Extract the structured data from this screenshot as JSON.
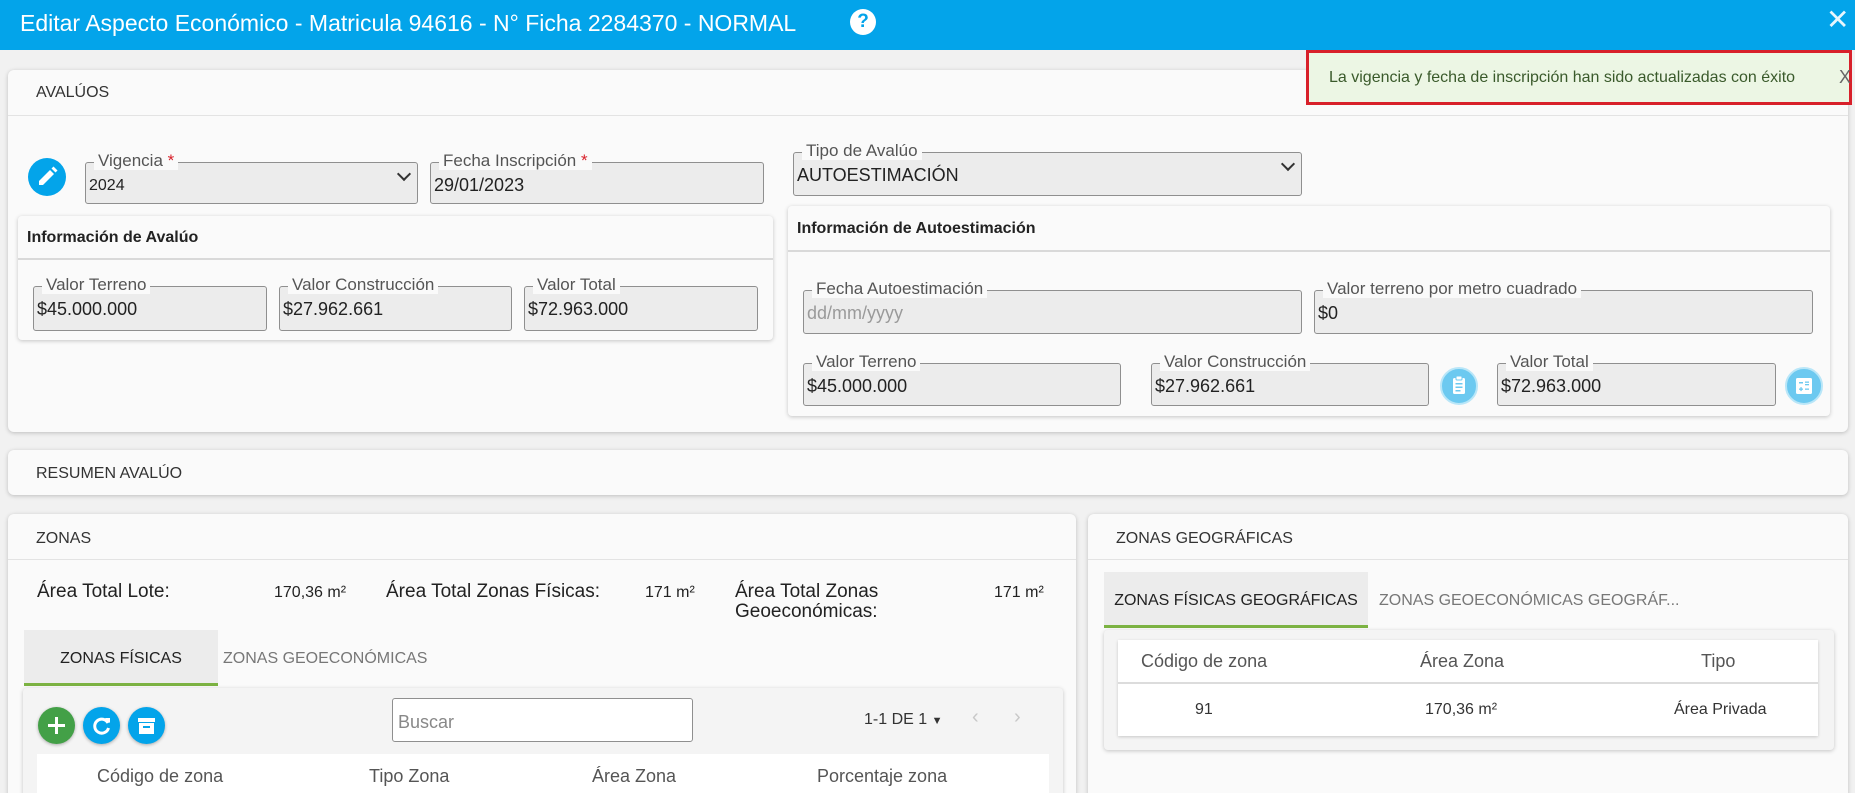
{
  "window": {
    "title": "Editar Aspecto Económico - Matricula 94616 - N° Ficha 2284370 - NORMAL",
    "help_icon": "question-circle-icon",
    "close_icon": "close-icon",
    "accent_color": "#03a4ea"
  },
  "toast": {
    "message": "La vigencia y fecha de inscripción han sido actualizadas con éxito",
    "close": "X",
    "border_color": "#d8202a"
  },
  "avaluos": {
    "header": "AVALÚOS",
    "vigencia": {
      "label": "Vigencia",
      "required": "*",
      "value": "2024"
    },
    "fecha_inscripcion": {
      "label": "Fecha Inscripción",
      "required": "*",
      "value": "29/01/2023"
    },
    "tipo_avaluo": {
      "label": "Tipo de Avalúo",
      "value": "AUTOESTIMACIÓN"
    },
    "info_avaluo": {
      "title": "Información de Avalúo",
      "valor_terreno": {
        "label": "Valor Terreno",
        "value": "$45.000.000"
      },
      "valor_construccion": {
        "label": "Valor Construcción",
        "value": "$27.962.661"
      },
      "valor_total": {
        "label": "Valor Total",
        "value": "$72.963.000"
      }
    },
    "info_autoestimacion": {
      "title": "Información de Autoestimación",
      "fecha": {
        "label": "Fecha Autoestimación",
        "placeholder": "dd/mm/yyyy"
      },
      "valor_m2": {
        "label": "Valor terreno por metro cuadrado",
        "value": "$0"
      },
      "valor_terreno": {
        "label": "Valor Terreno",
        "value": "$45.000.000"
      },
      "valor_construccion": {
        "label": "Valor Construcción",
        "value": "$27.962.661"
      },
      "valor_total": {
        "label": "Valor Total",
        "value": "$72.963.000"
      }
    }
  },
  "resumen": {
    "header": "RESUMEN AVALÚO"
  },
  "zonas": {
    "header": "ZONAS",
    "area_total_lote": {
      "label": "Área Total Lote:",
      "value": "170,36 m²"
    },
    "area_total_fisicas": {
      "label": "Área Total Zonas Físicas:",
      "value": "171 m²"
    },
    "area_total_geo": {
      "label": "Área Total Zonas Geoeconómicas:",
      "value": "171 m²"
    },
    "tabs": [
      "ZONAS FÍSICAS",
      "ZONAS GEOECONÓMICAS"
    ],
    "search_placeholder": "Buscar",
    "pagination": "1-1 DE 1",
    "columns": [
      "Código de zona",
      "Tipo Zona",
      "Área Zona",
      "Porcentaje zona"
    ]
  },
  "zonas_geo": {
    "header": "ZONAS GEOGRÁFICAS",
    "tabs": [
      "ZONAS FÍSICAS GEOGRÁFICAS",
      "ZONAS GEOECONÓMICAS GEOGRÁF..."
    ],
    "columns": [
      "Código de zona",
      "Área Zona",
      "Tipo"
    ],
    "rows": [
      {
        "codigo": "91",
        "area": "170,36 m²",
        "tipo": "Área Privada"
      }
    ]
  }
}
